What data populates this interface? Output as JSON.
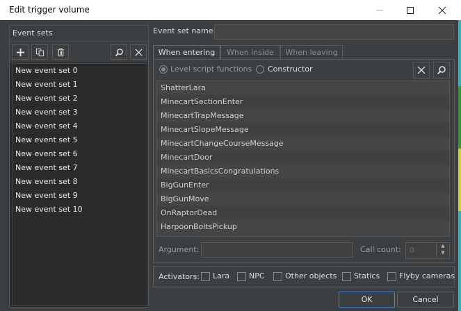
{
  "window": {
    "title": "Edit trigger volume"
  },
  "event_sets": {
    "header": "Event sets",
    "items": [
      "New event set 0",
      "New event set 1",
      "New event set 2",
      "New event set 3",
      "New event set 4",
      "New event set 5",
      "New event set 6",
      "New event set 7",
      "New event set 8",
      "New event set 9",
      "New event set 10"
    ]
  },
  "event_set_name": {
    "label": "Event set name:",
    "value": ""
  },
  "tabs": [
    {
      "label": "When entering",
      "active": true
    },
    {
      "label": "When inside",
      "active": false
    },
    {
      "label": "When leaving",
      "active": false
    }
  ],
  "mode": {
    "level_script_label": "Level script functions",
    "constructor_label": "Constructor",
    "selected": "Level script functions"
  },
  "functions": [
    "ShatterLara",
    "MinecartSectionEnter",
    "MinecartTrapMessage",
    "MinecartSlopeMessage",
    "MinecartChangeCourseMessage",
    "MinecartDoor",
    "MinecartBasicsCongratulations",
    "BigGunEnter",
    "BigGunMove",
    "OnRaptorDead",
    "HarpoonBoltsPickup"
  ],
  "argument": {
    "label": "Argument:",
    "value": ""
  },
  "call_count": {
    "label": "Call count:",
    "value": "0"
  },
  "activators": {
    "label": "Activators:",
    "items": [
      {
        "label": "Lara",
        "checked": false
      },
      {
        "label": "NPC",
        "checked": false
      },
      {
        "label": "Other objects",
        "checked": false
      },
      {
        "label": "Statics",
        "checked": false
      },
      {
        "label": "Flyby cameras",
        "checked": false
      }
    ]
  },
  "buttons": {
    "ok": "OK",
    "cancel": "Cancel"
  },
  "icons": {
    "add": "plus-icon",
    "copy": "copy-icon",
    "delete": "trash-icon",
    "search": "search-icon",
    "clear": "close-icon"
  }
}
